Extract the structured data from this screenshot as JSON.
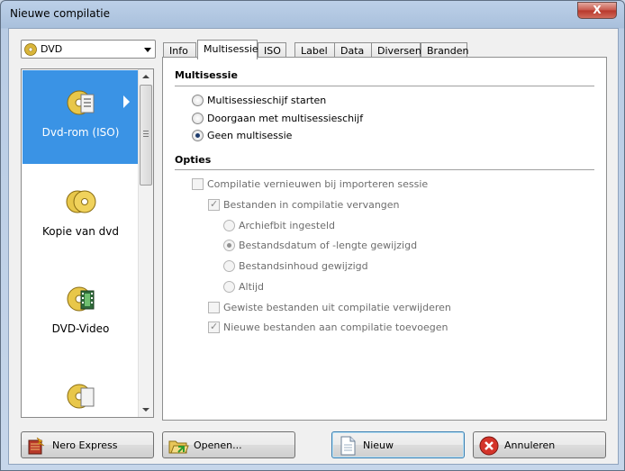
{
  "window": {
    "title": "Nieuwe compilatie",
    "close_glyph": "X"
  },
  "type_select": {
    "value": "DVD",
    "icon": "dvd-disc-icon"
  },
  "type_list": {
    "items": [
      {
        "label": "Dvd-rom (ISO)",
        "icon": "dvd-rom-iso-icon",
        "selected": true
      },
      {
        "label": "Kopie van dvd",
        "icon": "dvd-copy-icon"
      },
      {
        "label": "DVD-Video",
        "icon": "dvd-video-icon"
      },
      {
        "label": "",
        "icon": "dvd-disc-icon"
      }
    ]
  },
  "tabs": [
    "Info",
    "Multisessie",
    "ISO",
    "Label",
    "Data",
    "Diversen",
    "Branden"
  ],
  "active_tab": "Multisessie",
  "multisession": {
    "heading": "Multisessie",
    "options": [
      {
        "label": "Multisessieschijf starten",
        "checked": false
      },
      {
        "label": "Doorgaan met multisessieschijf",
        "checked": false
      },
      {
        "label": "Geen multisessie",
        "checked": true
      }
    ]
  },
  "options": {
    "heading": "Opties",
    "renew_compilation": "Compilatie vernieuwen bij importeren sessie",
    "replace_files": "Bestanden in compilatie vervangen",
    "replace_conditions": [
      {
        "label": "Archiefbit ingesteld",
        "checked": false
      },
      {
        "label": "Bestandsdatum of -lengte gewijzigd",
        "checked": true
      },
      {
        "label": "Bestandsinhoud gewijzigd",
        "checked": false
      },
      {
        "label": "Altijd",
        "checked": false
      }
    ],
    "remove_deleted": "Gewiste bestanden uit compilatie verwijderen",
    "add_new": "Nieuwe bestanden aan compilatie toevoegen"
  },
  "buttons": {
    "nero_express": "Nero Express",
    "open": "Openen...",
    "new": "Nieuw",
    "cancel": "Annuleren"
  },
  "colors": {
    "selection": "#3a93e5",
    "accent_border": "#3c7fb1"
  }
}
